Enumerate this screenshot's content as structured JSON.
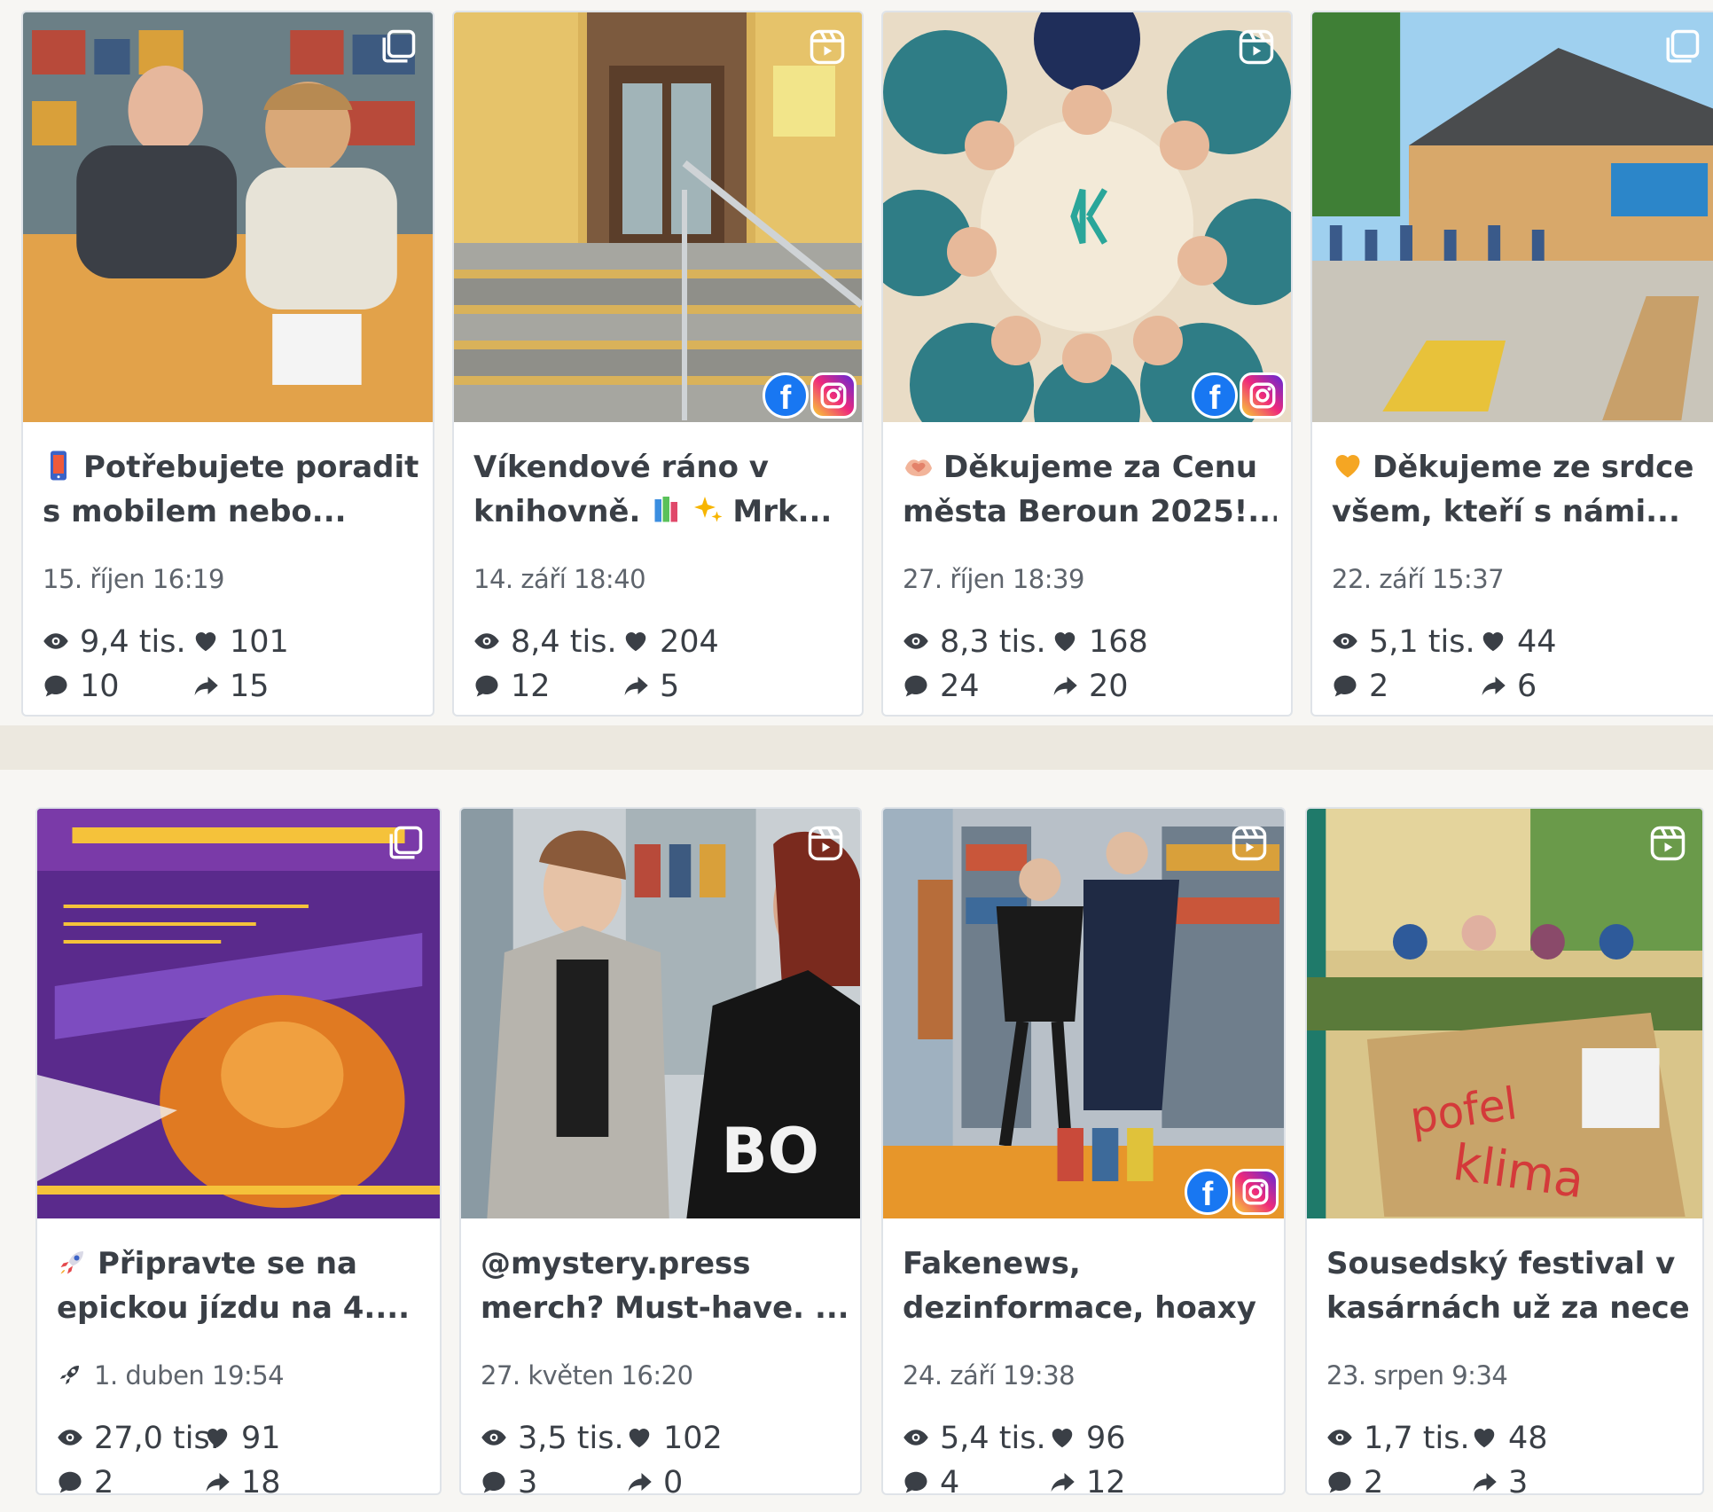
{
  "colors": {
    "page_background": "#ece8df",
    "panel_background": "#f7f6f3",
    "card_border": "#dfe3e8",
    "text_primary": "#3a3f46",
    "text_secondary": "#5e646c",
    "facebook_blue": "#1877f2"
  },
  "platform_labels": {
    "facebook": "f"
  },
  "rows": [
    {
      "cards": [
        {
          "type_icon": "carousel-icon",
          "caption_emoji": "mobile-phone-emoji",
          "caption_lines": [
            "Potřebujete poradit",
            "s mobilem nebo..."
          ],
          "date": "15. říjen 16:19",
          "views": "9,4 tis.",
          "likes": "101",
          "comments": "10",
          "shares": "15",
          "platforms": []
        },
        {
          "type_icon": "reel-icon",
          "caption_emoji": "",
          "caption_lines": [
            "Víkendové ráno v",
            "knihovně."
          ],
          "caption_suffix": "Mrk...",
          "date": "14. září 18:40",
          "views": "8,4 tis.",
          "likes": "204",
          "comments": "12",
          "shares": "5",
          "platforms": [
            "facebook",
            "instagram"
          ]
        },
        {
          "type_icon": "reel-icon",
          "caption_emoji": "heart-hands-emoji",
          "caption_lines": [
            "Děkujeme za Cenu",
            "města Beroun 2025!..."
          ],
          "date": "27. říjen 18:39",
          "views": "8,3 tis.",
          "likes": "168",
          "comments": "24",
          "shares": "20",
          "platforms": [
            "facebook",
            "instagram"
          ]
        },
        {
          "type_icon": "carousel-icon",
          "caption_emoji": "orange-heart-emoji",
          "caption_lines": [
            "Děkujeme ze srdce",
            "všem, kteří s námi..."
          ],
          "date": "22. září 15:37",
          "views": "5,1 tis.",
          "likes": "44",
          "comments": "2",
          "shares": "6",
          "platforms": []
        }
      ]
    },
    {
      "cards": [
        {
          "type_icon": "carousel-icon",
          "caption_emoji": "rocket-emoji",
          "caption_lines": [
            "Připravte se na",
            "epickou jízdu na 4...."
          ],
          "date": "1. duben 19:54",
          "date_icon": "rocket-icon",
          "views": "27,0 tis.",
          "likes": "91",
          "comments": "2",
          "shares": "18",
          "platforms": []
        },
        {
          "type_icon": "reel-icon",
          "caption_emoji": "",
          "caption_lines": [
            "@mystery.press",
            "merch? Must-have. ..."
          ],
          "date": "27. květen 16:20",
          "views": "3,5 tis.",
          "likes": "102",
          "comments": "3",
          "shares": "0",
          "platforms": []
        },
        {
          "type_icon": "reel-icon",
          "caption_emoji": "",
          "caption_lines": [
            "Fakenews,",
            "dezinformace, hoaxy ..."
          ],
          "date": "24. září 19:38",
          "views": "5,4 tis.",
          "likes": "96",
          "comments": "4",
          "shares": "12",
          "platforms": [
            "facebook",
            "instagram"
          ]
        },
        {
          "type_icon": "reel-icon",
          "caption_emoji": "",
          "caption_lines": [
            "Sousedský festival v",
            "kasárnách už za necel..."
          ],
          "date": "23. srpen 9:34",
          "views": "1,7 tis.",
          "likes": "48",
          "comments": "2",
          "shares": "3",
          "platforms": []
        }
      ]
    }
  ]
}
